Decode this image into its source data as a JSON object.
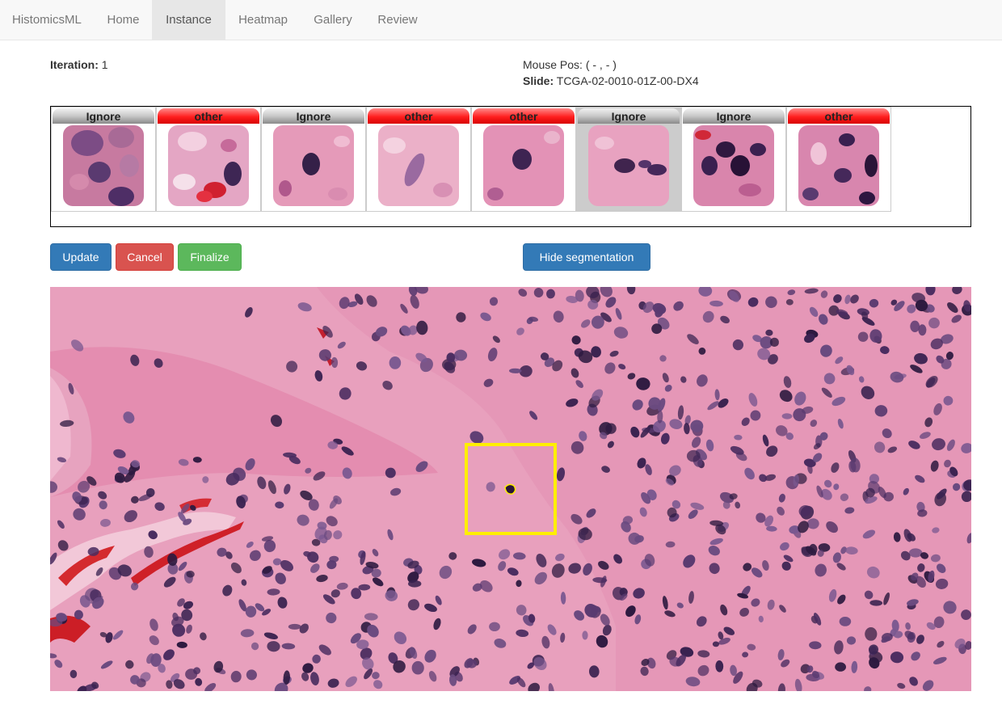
{
  "navbar": {
    "brand": "HistomicsML",
    "items": [
      {
        "label": "Home",
        "active": false
      },
      {
        "label": "Instance",
        "active": true
      },
      {
        "label": "Heatmap",
        "active": false
      },
      {
        "label": "Gallery",
        "active": false
      },
      {
        "label": "Review",
        "active": false
      }
    ]
  },
  "info": {
    "iteration_label": "Iteration:",
    "iteration_value": "1",
    "mouse_pos_label": "Mouse Pos:",
    "mouse_pos_value": "( - , - )",
    "slide_label": "Slide:",
    "slide_value": "TCGA-02-0010-01Z-00-DX4"
  },
  "thumbnails": [
    {
      "label": "Ignore",
      "color": "gray",
      "selected": false
    },
    {
      "label": "other",
      "color": "red",
      "selected": false
    },
    {
      "label": "Ignore",
      "color": "gray",
      "selected": false
    },
    {
      "label": "other",
      "color": "red",
      "selected": false
    },
    {
      "label": "other",
      "color": "red",
      "selected": false
    },
    {
      "label": "Ignore",
      "color": "gray",
      "selected": true
    },
    {
      "label": "Ignore",
      "color": "gray",
      "selected": false
    },
    {
      "label": "other",
      "color": "red",
      "selected": false
    }
  ],
  "buttons": {
    "update": "Update",
    "cancel": "Cancel",
    "finalize": "Finalize",
    "hide_segmentation": "Hide segmentation"
  },
  "colors": {
    "primary": "#337ab7",
    "danger": "#d9534f",
    "success": "#5cb85c",
    "selection_box": "#ffee00",
    "tissue_pink": "#e89ab8",
    "stroma_pink": "#e58aa8",
    "nucleus_purple": "#4a2a5c",
    "rbc_red": "#d8202a"
  }
}
